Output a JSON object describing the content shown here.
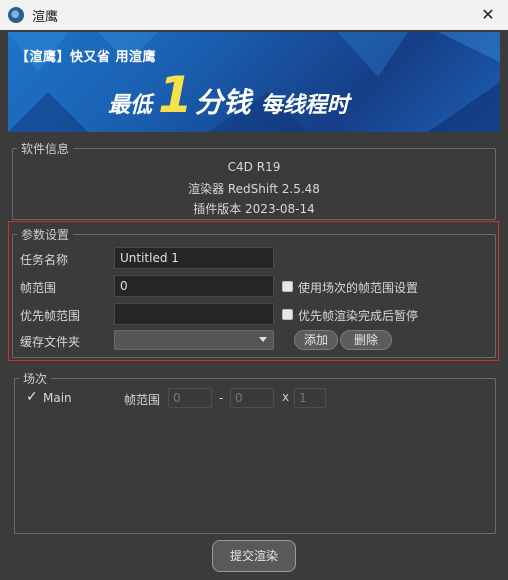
{
  "window": {
    "title": "渲鹰",
    "close_label": "✕"
  },
  "banner": {
    "line1": "【渲鹰】快又省 用渲鹰",
    "pre": "最低",
    "big": "1",
    "mid": "分钱",
    "post": "每线程时",
    "accent_color": "#f5e14a"
  },
  "software_info": {
    "legend": "软件信息",
    "app": "C4D R19",
    "renderer": "渲染器 RedShift 2.5.48",
    "plugin_version": "插件版本 2023-08-14"
  },
  "params": {
    "legend": "参数设置",
    "task_name_label": "任务名称",
    "task_name_value": "Untitled 1",
    "frame_range_label": "帧范围",
    "frame_range_value": "0",
    "use_scene_range_label": "使用场次的帧范围设置",
    "priority_range_label": "优先帧范围",
    "priority_range_value": "",
    "pause_after_priority_label": "优先帧渲染完成后暂停",
    "cache_folder_label": "缓存文件夹",
    "cache_folder_value": "",
    "add_label": "添加",
    "delete_label": "删除",
    "highlight_color": "#c8322a"
  },
  "scenes": {
    "legend": "场次",
    "check_mark": "✓",
    "item_name": "Main",
    "range_label": "帧范围",
    "from_value": "0",
    "dash": "-",
    "to_value": "0",
    "x_label": "x",
    "count_value": "1"
  },
  "submit_label": "提交渲染"
}
